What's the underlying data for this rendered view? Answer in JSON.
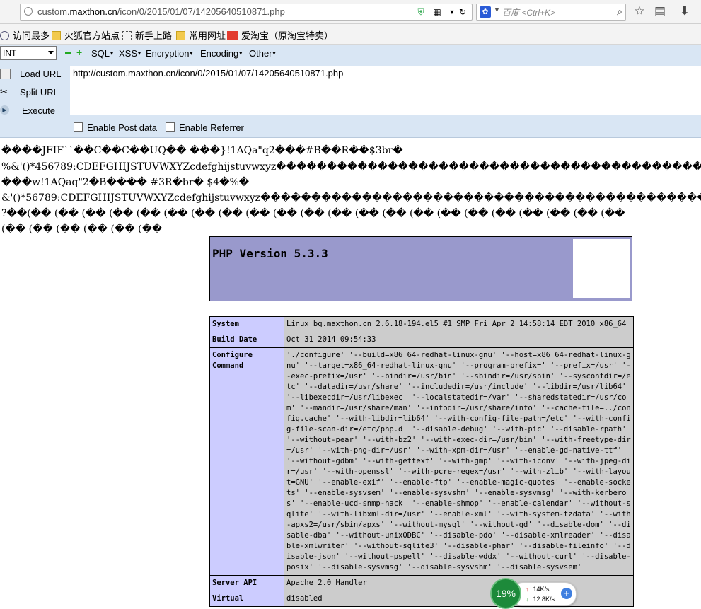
{
  "address_bar": {
    "url_prefix": "custom.",
    "url_domain": "maxthon.cn",
    "url_path": "/icon/0/2015/01/07/14205640510871.php",
    "search_placeholder": "百度 <Ctrl+K>"
  },
  "bookmarks": [
    {
      "label": "访问最多",
      "icon": "gear-icon"
    },
    {
      "label": "火狐官方站点",
      "icon": "folder-icon"
    },
    {
      "label": "新手上路",
      "icon": "dashed-box-icon"
    },
    {
      "label": "常用网址",
      "icon": "folder-icon"
    },
    {
      "label": "爱淘宝（原淘宝特卖）",
      "icon": "taobao-icon"
    }
  ],
  "hackbar": {
    "select_value": "INT",
    "menus": [
      "SQL",
      "XSS",
      "Encryption",
      "Encoding",
      "Other"
    ],
    "load_url": "Load URL",
    "split_url": "Split URL",
    "execute": "Execute",
    "url_text": "http://custom.maxthon.cn/icon/0/2015/01/07/14205640510871.php",
    "post_label": "Enable Post data",
    "referrer_label": "Enable Referrer"
  },
  "garbage_lines": [
    "����JFIF``��C��C��UQ�� ���}!1AQa\"q2���#B��R��$3br�",
    "%&'()*456789:CDEFGHIJSTUVWXYZcdefghijstuvwxyz���������������������������������������������",
    " ���w!1AQaq\"2�B���� #3R�br� $4�%�",
    "&'()*56789:CDEFGHIJSTUVWXYZcdefghijstuvwxyz���������������������������������������������",
    "?��(�� (�� (�� (�� (�� (�� (�� (�� (�� (�� (�� (�� (�� (�� (�� (�� (�� (�� (�� (�� (�� (��",
    "(�� (�� (�� (�� (�� (��"
  ],
  "php": {
    "title": "PHP Version 5.3.3",
    "rows": [
      {
        "key": "System",
        "value": "Linux bq.maxthon.cn 2.6.18-194.el5 #1 SMP Fri Apr 2 14:58:14 EDT 2010 x86_64"
      },
      {
        "key": "Build Date",
        "value": "Oct 31 2014 09:54:33"
      },
      {
        "key": "Configure Command",
        "value": "'./configure' '--build=x86_64-redhat-linux-gnu' '--host=x86_64-redhat-linux-gnu' '--target=x86_64-redhat-linux-gnu' '--program-prefix=' '--prefix=/usr' '--exec-prefix=/usr' '--bindir=/usr/bin' '--sbindir=/usr/sbin' '--sysconfdir=/etc' '--datadir=/usr/share' '--includedir=/usr/include' '--libdir=/usr/lib64' '--libexecdir=/usr/libexec' '--localstatedir=/var' '--sharedstatedir=/usr/com' '--mandir=/usr/share/man' '--infodir=/usr/share/info' '--cache-file=../config.cache' '--with-libdir=lib64' '--with-config-file-path=/etc' '--with-config-file-scan-dir=/etc/php.d' '--disable-debug' '--with-pic' '--disable-rpath' '--without-pear' '--with-bz2' '--with-exec-dir=/usr/bin' '--with-freetype-dir=/usr' '--with-png-dir=/usr' '--with-xpm-dir=/usr' '--enable-gd-native-ttf' '--without-gdbm' '--with-gettext' '--with-gmp' '--with-iconv' '--with-jpeg-dir=/usr' '--with-openssl' '--with-pcre-regex=/usr' '--with-zlib' '--with-layout=GNU' '--enable-exif' '--enable-ftp' '--enable-magic-quotes' '--enable-sockets' '--enable-sysvsem' '--enable-sysvshm' '--enable-sysvmsg' '--with-kerberos' '--enable-ucd-snmp-hack' '--enable-shmop' '--enable-calendar' '--without-sqlite' '--with-libxml-dir=/usr' '--enable-xml' '--with-system-tzdata' '--with-apxs2=/usr/sbin/apxs' '--without-mysql' '--without-gd' '--disable-dom' '--disable-dba' '--without-unixODBC' '--disable-pdo' '--disable-xmlreader' '--disable-xmlwriter' '--without-sqlite3' '--disable-phar' '--disable-fileinfo' '--disable-json' '--without-pspell' '--disable-wddx' '--without-curl' '--disable-posix' '--disable-sysvmsg' '--disable-sysvshm' '--disable-sysvsem'"
      },
      {
        "key": "Server API",
        "value": "Apache 2.0 Handler"
      },
      {
        "key": "Virtual",
        "value": "disabled"
      }
    ]
  },
  "net_widget": {
    "percent": "19%",
    "up": "14K/s",
    "down": "12.8K/s"
  },
  "colors": {
    "php_header": "#9999cc",
    "php_key": "#ccccff",
    "php_value": "#cccccc",
    "hackbar": "#d9e6f4"
  }
}
